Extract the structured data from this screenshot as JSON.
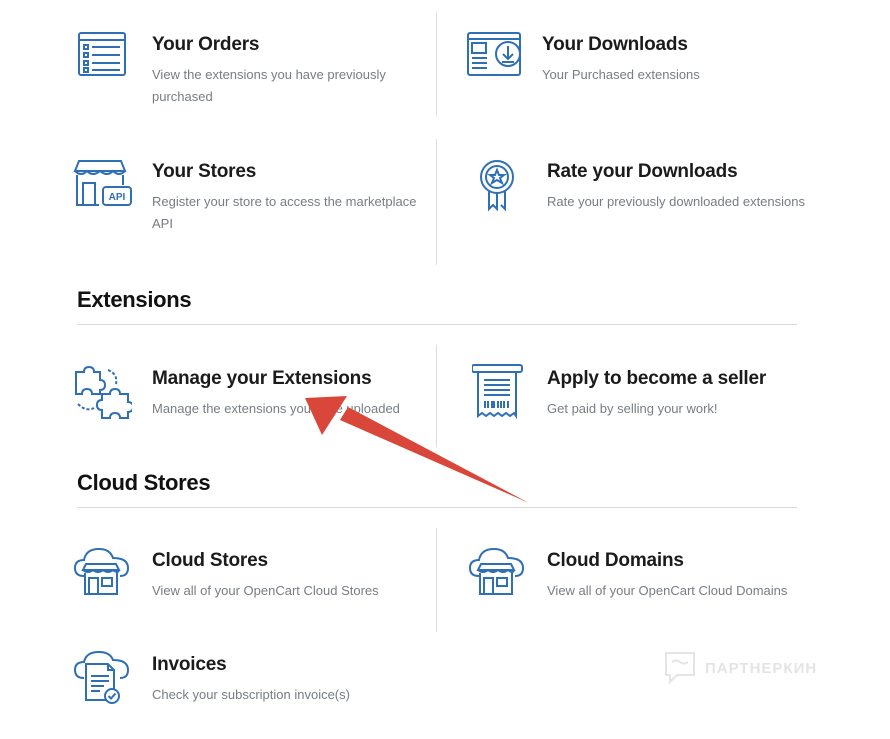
{
  "account": {
    "orders": {
      "title": "Your Orders",
      "desc": "View the extensions you have previously purchased",
      "icon": "orders-list-icon"
    },
    "downloads": {
      "title": "Your Downloads",
      "desc": "Your Purchased extensions",
      "icon": "download-window-icon"
    },
    "stores": {
      "title": "Your Stores",
      "desc": "Register your store to access the marketplace API",
      "icon": "store-api-icon",
      "api_badge": "API"
    },
    "rate": {
      "title": "Rate your Downloads",
      "desc": "Rate your previously downloaded extensions",
      "icon": "award-ribbon-icon"
    }
  },
  "extensions": {
    "section_title": "Extensions",
    "manage": {
      "title": "Manage your Extensions",
      "desc": "Manage the extensions you have uploaded",
      "icon": "puzzle-pieces-icon"
    },
    "seller": {
      "title": "Apply to become a seller",
      "desc": "Get paid by selling your work!",
      "icon": "receipt-icon"
    }
  },
  "cloud": {
    "section_title": "Cloud Stores",
    "stores": {
      "title": "Cloud Stores",
      "desc": "View all of your OpenCart Cloud Stores",
      "icon": "cloud-store-icon"
    },
    "domains": {
      "title": "Cloud Domains",
      "desc": "View all of your OpenCart Cloud Domains",
      "icon": "cloud-store-icon"
    },
    "invoices": {
      "title": "Invoices",
      "desc": "Check your subscription invoice(s)",
      "icon": "cloud-invoice-icon"
    }
  },
  "watermark": {
    "text": "ПАРТНЕРКИН"
  },
  "colors": {
    "icon_blue": "#2f6fb4",
    "arrow_red": "#d9463a",
    "title": "#1b1b1b",
    "desc": "#777d83"
  }
}
